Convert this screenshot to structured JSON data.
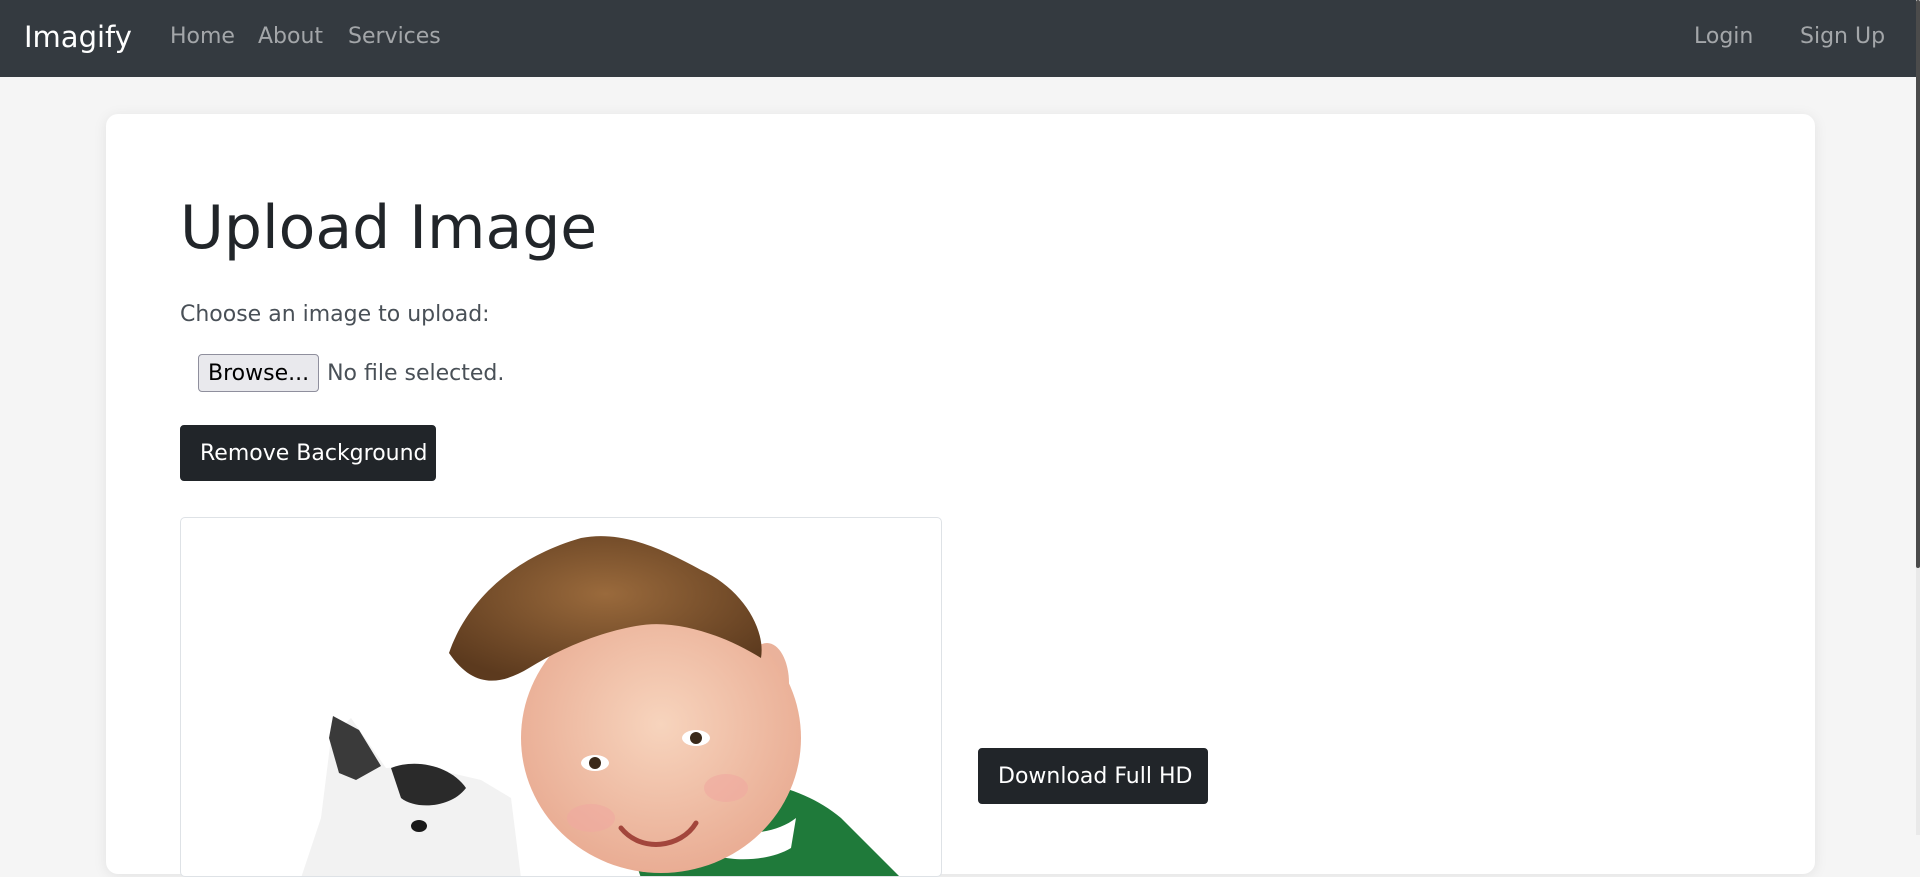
{
  "navbar": {
    "brand": "Imagify",
    "links": {
      "home": "Home",
      "about": "About",
      "services": "Services"
    },
    "auth": {
      "login": "Login",
      "signup": "Sign Up"
    }
  },
  "main": {
    "title": "Upload Image",
    "upload_label": "Choose an image to upload:",
    "file_input": {
      "button_label": "Browse...",
      "status": "No file selected."
    },
    "remove_background_label": "Remove Background",
    "download_label": "Download Full HD"
  },
  "colors": {
    "navbar_bg": "#343a40",
    "button_dark": "#212529",
    "page_bg": "#f5f5f5"
  }
}
